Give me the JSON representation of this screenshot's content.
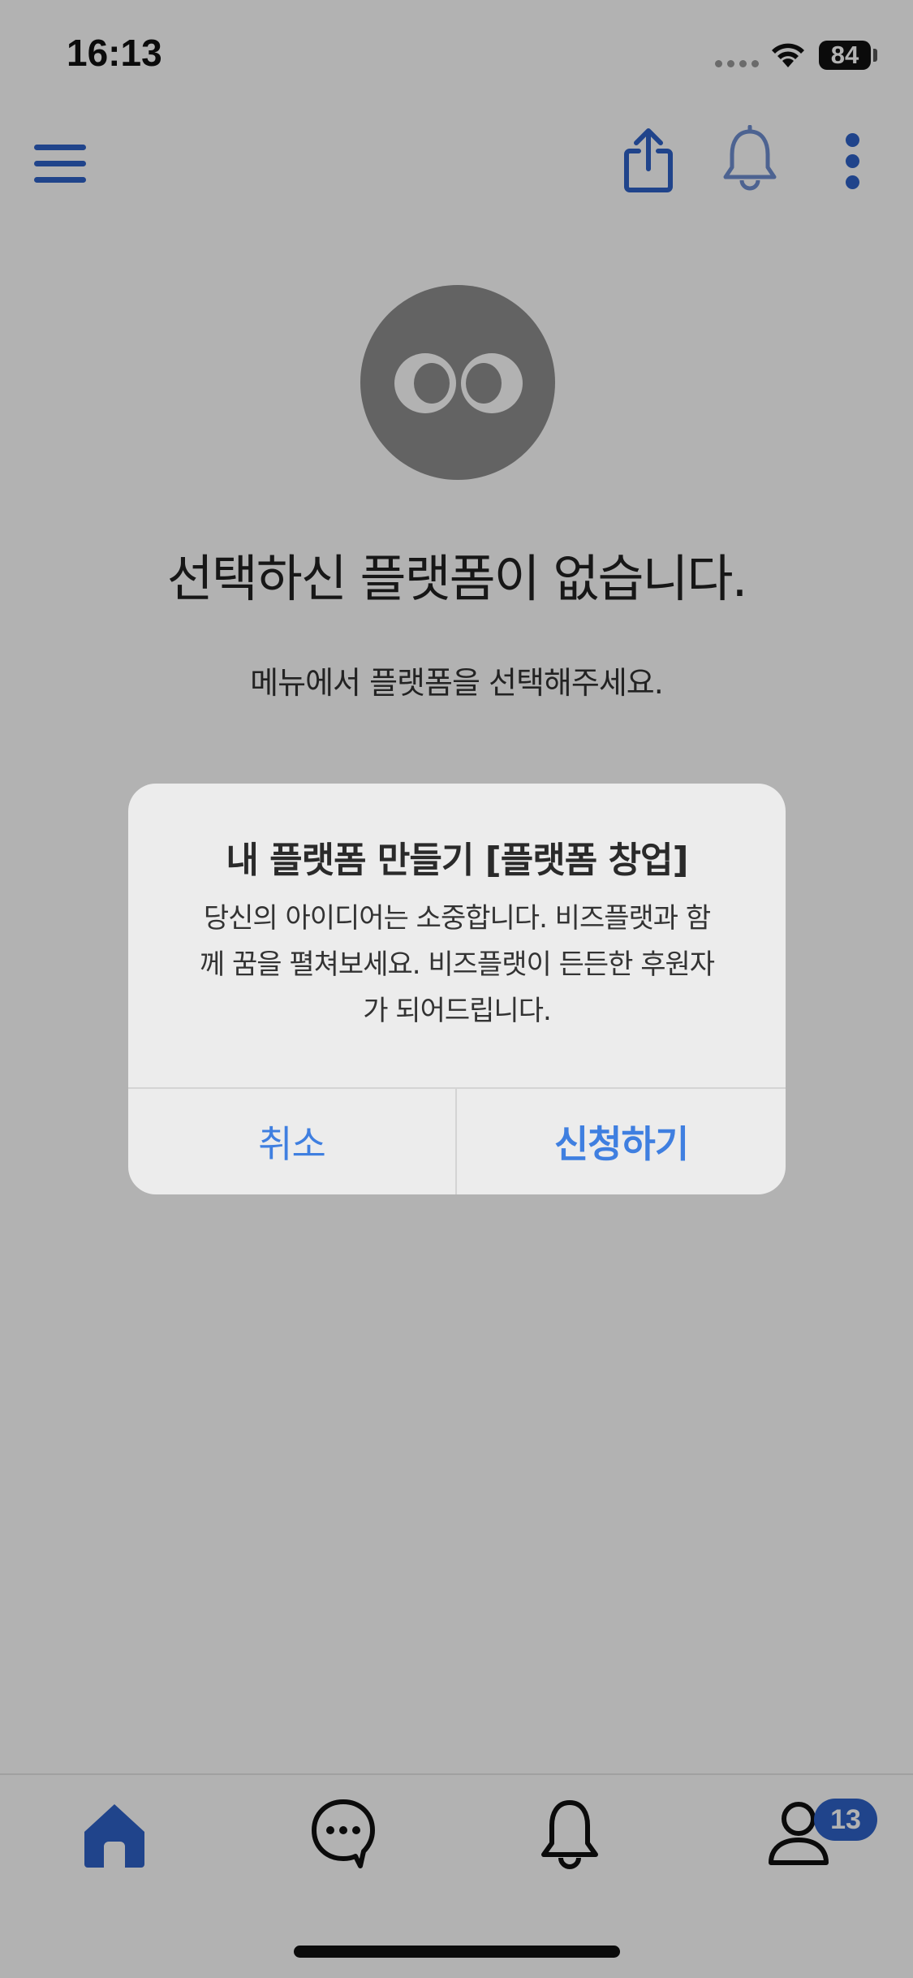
{
  "status_bar": {
    "time": "16:13",
    "battery": "84",
    "icons": [
      "cellular-signal-icon",
      "wifi-icon",
      "battery-icon"
    ]
  },
  "top_bar": {
    "icons": [
      "hamburger-menu-icon",
      "share-icon",
      "bell-icon",
      "more-vertical-icon"
    ],
    "accent_color": "#2f62c7"
  },
  "empty_state": {
    "title": "선택하신 플랫폼이 없습니다.",
    "subtitle": "메뉴에서 플랫폼을 선택해주세요."
  },
  "alert": {
    "title": "내 플랫폼 만들기 [플랫폼 창업]",
    "message_lines": [
      "당신의 아이디어는 소중합니다. 비즈플랫과 함",
      "께 꿈을 펼쳐보세요. 비즈플랫이 든든한 후원자",
      "가 되어드립니다."
    ],
    "cancel_label": "취소",
    "confirm_label": "신청하기",
    "button_color": "#3f7fe0"
  },
  "tab_bar": {
    "tabs": [
      {
        "icon": "home-icon",
        "active": true
      },
      {
        "icon": "chat-bubble-icon",
        "active": false
      },
      {
        "icon": "bell-icon",
        "active": false
      },
      {
        "icon": "profile-icon",
        "active": false
      }
    ],
    "profile_badge": "13"
  }
}
